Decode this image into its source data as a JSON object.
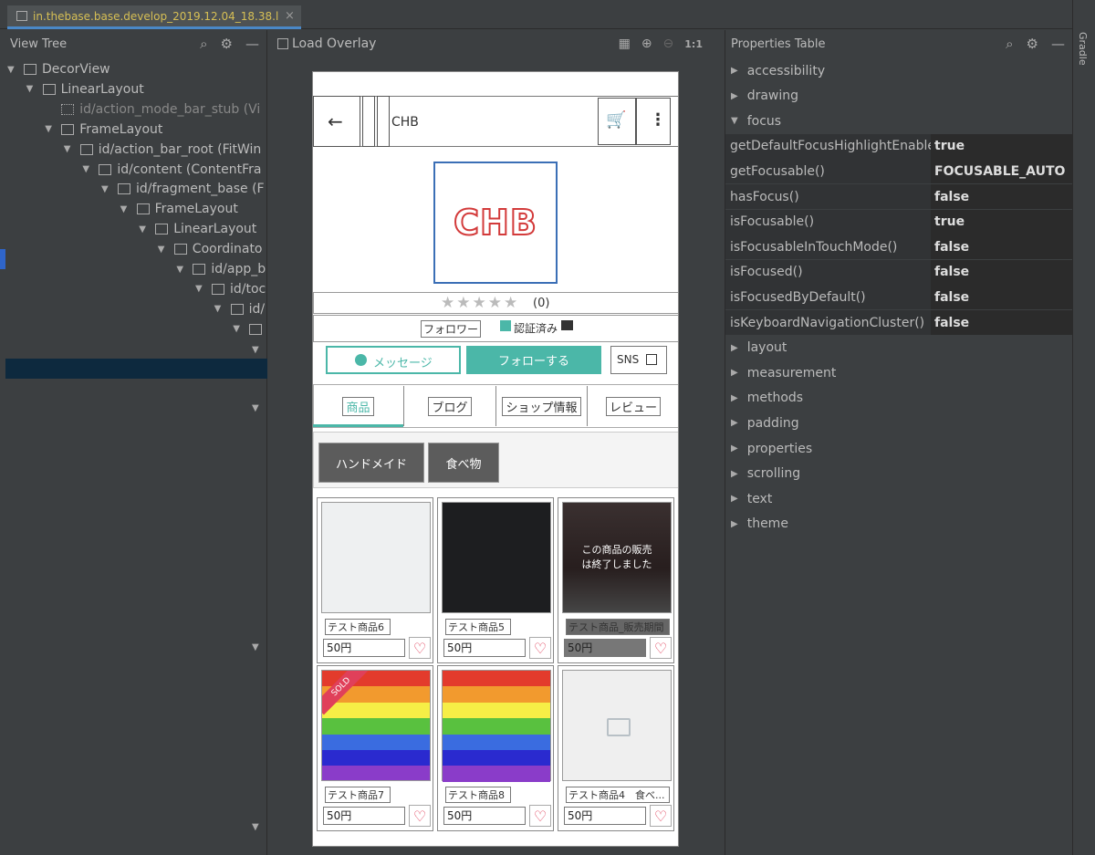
{
  "tab": {
    "title": "in.thebase.base.develop_2019.12.04_18.38.li",
    "close": "×"
  },
  "gradle": "Gradle",
  "view_tree": {
    "title": "View Tree",
    "nodes": [
      {
        "label": "DecorView",
        "depth": 0
      },
      {
        "label": "LinearLayout",
        "depth": 1
      },
      {
        "label": "id/action_mode_bar_stub (Vi",
        "depth": 2
      },
      {
        "label": "FrameLayout",
        "depth": 2
      },
      {
        "label": "id/action_bar_root (FitWin",
        "depth": 3
      },
      {
        "label": "id/content (ContentFra",
        "depth": 4
      },
      {
        "label": "id/fragment_base (F",
        "depth": 5
      },
      {
        "label": "FrameLayout",
        "depth": 6
      },
      {
        "label": "LinearLayout",
        "depth": 7
      },
      {
        "label": "Coordinato",
        "depth": 8
      },
      {
        "label": "id/app_b",
        "depth": 9
      },
      {
        "label": "id/toc",
        "depth": 10
      },
      {
        "label": "id/",
        "depth": 11
      },
      {
        "label": "",
        "depth": 12
      }
    ]
  },
  "layout_inspector": {
    "load_overlay": "Load Overlay",
    "zoom": "1:1"
  },
  "phone": {
    "title": "CHB",
    "logo": "CHB",
    "rating_count": "(0)",
    "follower": "フォロワー",
    "verified": "認証済み",
    "message": "メッセージ",
    "follow": "フォローする",
    "sns": "SNS",
    "tabs": [
      "商品",
      "ブログ",
      "ショップ情報",
      "レビュー"
    ],
    "categories": [
      "ハンドメイド",
      "食べ物"
    ],
    "sold_out": "この商品の販売は終了しました",
    "sold_badge": "SOLD",
    "items": [
      {
        "name": "テスト商品6",
        "price": "50円"
      },
      {
        "name": "テスト商品5",
        "price": "50円"
      },
      {
        "name": "テスト商品_販売期間",
        "price": "50円"
      },
      {
        "name": "テスト商品7",
        "price": "50円"
      },
      {
        "name": "テスト商品8",
        "price": "50円"
      },
      {
        "name": "テスト商品4　食べ...",
        "price": "50円"
      }
    ]
  },
  "properties": {
    "title": "Properties Table",
    "groups_before": [
      "accessibility",
      "drawing"
    ],
    "open_group": "focus",
    "focus_rows": [
      {
        "key": "getDefaultFocusHighlightEnable",
        "value": "true"
      },
      {
        "key": "getFocusable()",
        "value": "FOCUSABLE_AUTO"
      },
      {
        "key": "hasFocus()",
        "value": "false"
      },
      {
        "key": "isFocusable()",
        "value": "true"
      },
      {
        "key": "isFocusableInTouchMode()",
        "value": "false"
      },
      {
        "key": "isFocused()",
        "value": "false"
      },
      {
        "key": "isFocusedByDefault()",
        "value": "false"
      },
      {
        "key": "isKeyboardNavigationCluster()",
        "value": "false"
      }
    ],
    "groups_after": [
      "layout",
      "measurement",
      "methods",
      "padding",
      "properties",
      "scrolling",
      "text",
      "theme"
    ]
  }
}
